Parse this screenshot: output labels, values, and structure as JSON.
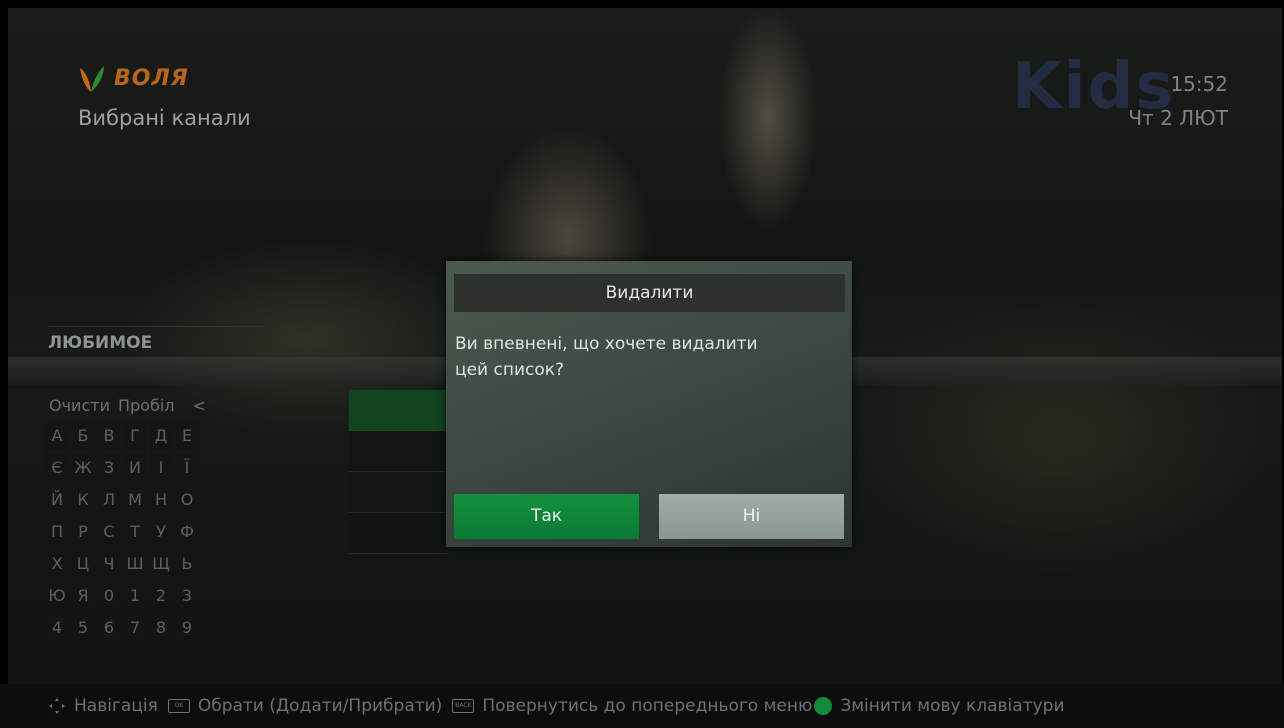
{
  "header": {
    "brand_text": "ВОЛЯ",
    "title": "Вибрані канали",
    "time": "15:52",
    "date": "Чт 2 ЛЮТ",
    "channel_logo_text": "Kids"
  },
  "list": {
    "title": "ЛЮБИМОЕ"
  },
  "keyboard": {
    "actions": [
      "Очисти",
      "Пробіл",
      "<"
    ],
    "rows": [
      [
        "А",
        "Б",
        "В",
        "Г",
        "Д",
        "Е"
      ],
      [
        "Є",
        "Ж",
        "З",
        "И",
        "І",
        "Ї"
      ],
      [
        "Й",
        "К",
        "Л",
        "М",
        "Н",
        "О"
      ],
      [
        "П",
        "Р",
        "С",
        "Т",
        "У",
        "Ф"
      ],
      [
        "Х",
        "Ц",
        "Ч",
        "Ш",
        "Щ",
        "Ь"
      ],
      [
        "Ю",
        "Я",
        "0",
        "1",
        "2",
        "3"
      ],
      [
        "4",
        "5",
        "6",
        "7",
        "8",
        "9"
      ]
    ]
  },
  "dialog": {
    "title": "Видалити",
    "message_line1": "Ви впевнені, що хочете видалити",
    "message_line2": "цей список?",
    "yes_label": "Так",
    "no_label": "Ні"
  },
  "footer": {
    "nav_label": "Навігація",
    "ok_icon_text": "OK",
    "ok_label": "Обрати (Додати/Прибрати)",
    "back_icon_text": "BACK",
    "back_label": "Повернутись до попереднього меню",
    "green_label": "Змінити мову клавіатури"
  },
  "colors": {
    "accent_green": "#0b7a33",
    "brand_orange": "#b8651a"
  }
}
